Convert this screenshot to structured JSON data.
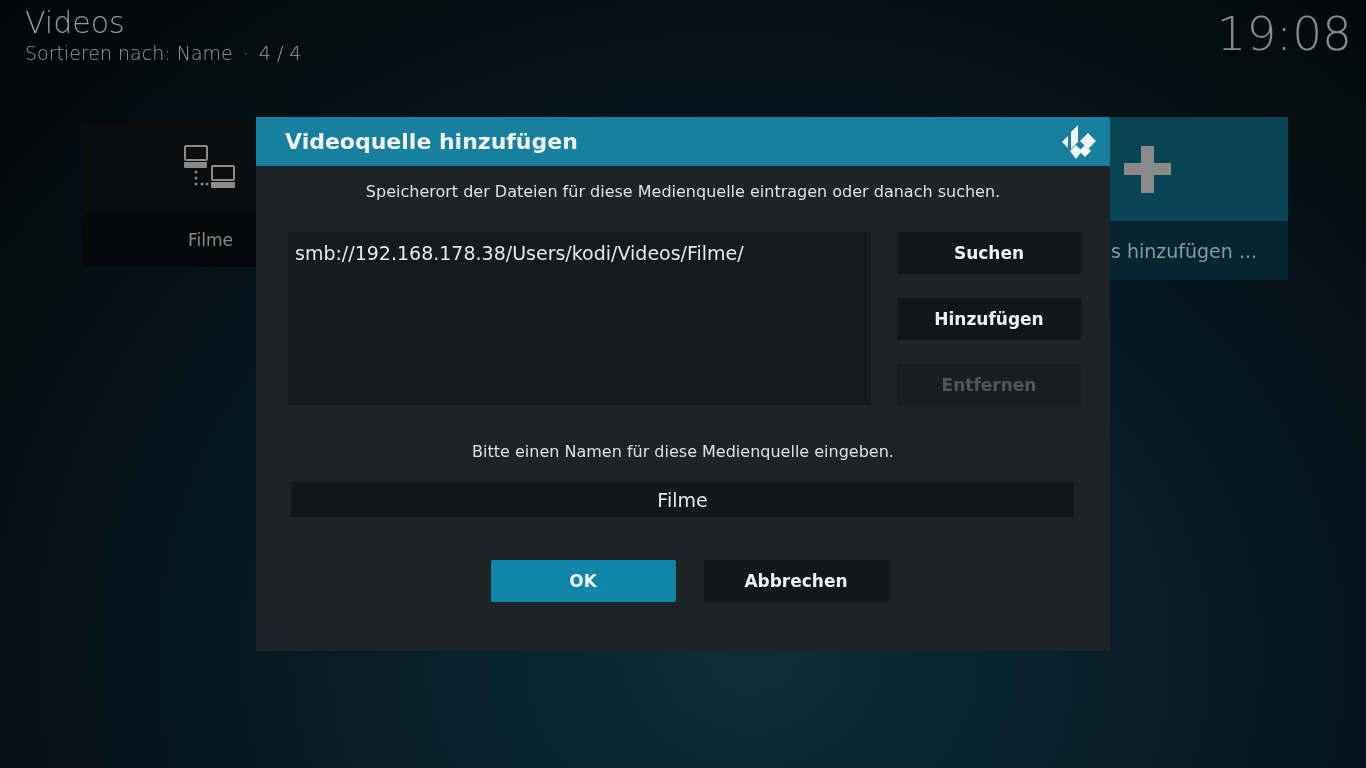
{
  "header": {
    "title": "Videos",
    "sort_label": "Sortieren nach: Name",
    "separator": "·",
    "count": "4 / 4",
    "clock": "19:08"
  },
  "tiles": [
    {
      "kind": "source",
      "label": "Filme",
      "selected": false
    },
    {
      "kind": "add",
      "label": "s hinzufügen ...",
      "selected": true
    }
  ],
  "dialog": {
    "title": "Videoquelle hinzufügen",
    "path_prompt": "Speicherort der Dateien für diese Medienquelle eintragen oder danach suchen.",
    "paths": [
      "smb://192.168.178.38/Users/kodi/Videos/Filme/"
    ],
    "side_buttons": [
      {
        "label": "Suchen",
        "disabled": false
      },
      {
        "label": "Hinzufügen",
        "disabled": false
      },
      {
        "label": "Entfernen",
        "disabled": true
      }
    ],
    "name_prompt": "Bitte einen Namen für diese Medienquelle eingeben.",
    "name_value": "Filme",
    "buttons": [
      {
        "label": "OK",
        "focused": true
      },
      {
        "label": "Abbrechen",
        "focused": false
      }
    ]
  }
}
